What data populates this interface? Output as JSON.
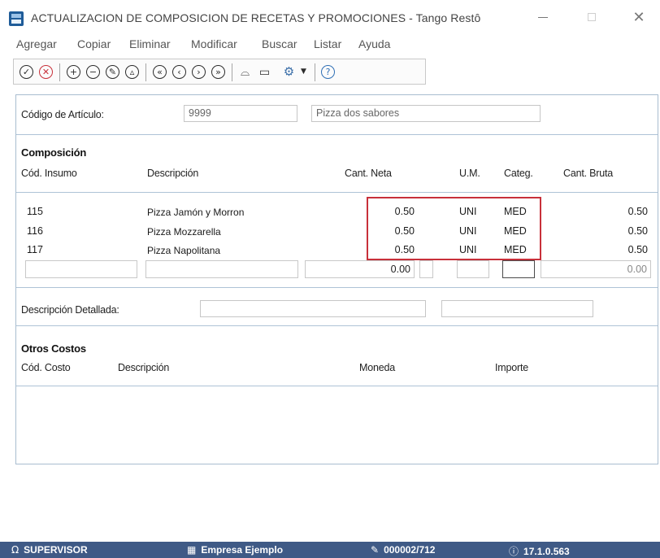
{
  "window": {
    "title": "ACTUALIZACION DE COMPOSICION DE RECETAS Y PROMOCIONES - Tango Restô"
  },
  "menu": [
    "Agregar",
    "Copiar",
    "Eliminar",
    "Modificar",
    "Buscar",
    "Listar",
    "Ayuda"
  ],
  "toolbar": {
    "icons": [
      "check-icon",
      "cancel-icon",
      "add-icon",
      "remove-icon",
      "edit-icon",
      "delete-icon",
      "first-icon",
      "previous-icon",
      "next-icon",
      "last-icon",
      "binoculars-icon",
      "monitor-icon",
      "gear-icon",
      "dropdown-icon",
      "help-icon"
    ]
  },
  "articulo": {
    "label": "Código de Artículo:",
    "code": "9999",
    "description": "Pizza dos sabores"
  },
  "composicion": {
    "title": "Composición",
    "columns": {
      "cod": "Cód. Insumo",
      "desc": "Descripción",
      "neta": "Cant. Neta",
      "um": "U.M.",
      "categ": "Categ.",
      "bruta": "Cant. Bruta"
    },
    "rows": [
      {
        "cod": "115",
        "desc": "Pizza Jamón y Morron",
        "neta": "0.50",
        "um": "UNI",
        "categ": "MED",
        "bruta": "0.50"
      },
      {
        "cod": "116",
        "desc": "Pizza Mozzarella",
        "neta": "0.50",
        "um": "UNI",
        "categ": "MED",
        "bruta": "0.50"
      },
      {
        "cod": "117",
        "desc": "Pizza Napolitana",
        "neta": "0.50",
        "um": "UNI",
        "categ": "MED",
        "bruta": "0.50"
      }
    ],
    "new_row": {
      "neta": "0.00",
      "bruta": "0.00"
    }
  },
  "detalle": {
    "label": "Descripción Detallada:"
  },
  "otros_costos": {
    "title": "Otros Costos",
    "columns": {
      "cod": "Cód. Costo",
      "desc": "Descripción",
      "moneda": "Moneda",
      "importe": "Importe"
    }
  },
  "status": {
    "user": "SUPERVISOR",
    "company": "Empresa Ejemplo",
    "serial": "000002/712",
    "version": "17.1.0.563"
  },
  "colors": {
    "statusbar": "#3f5a86",
    "highlight": "#c8303a",
    "panel_border": "#a9bdd0"
  }
}
